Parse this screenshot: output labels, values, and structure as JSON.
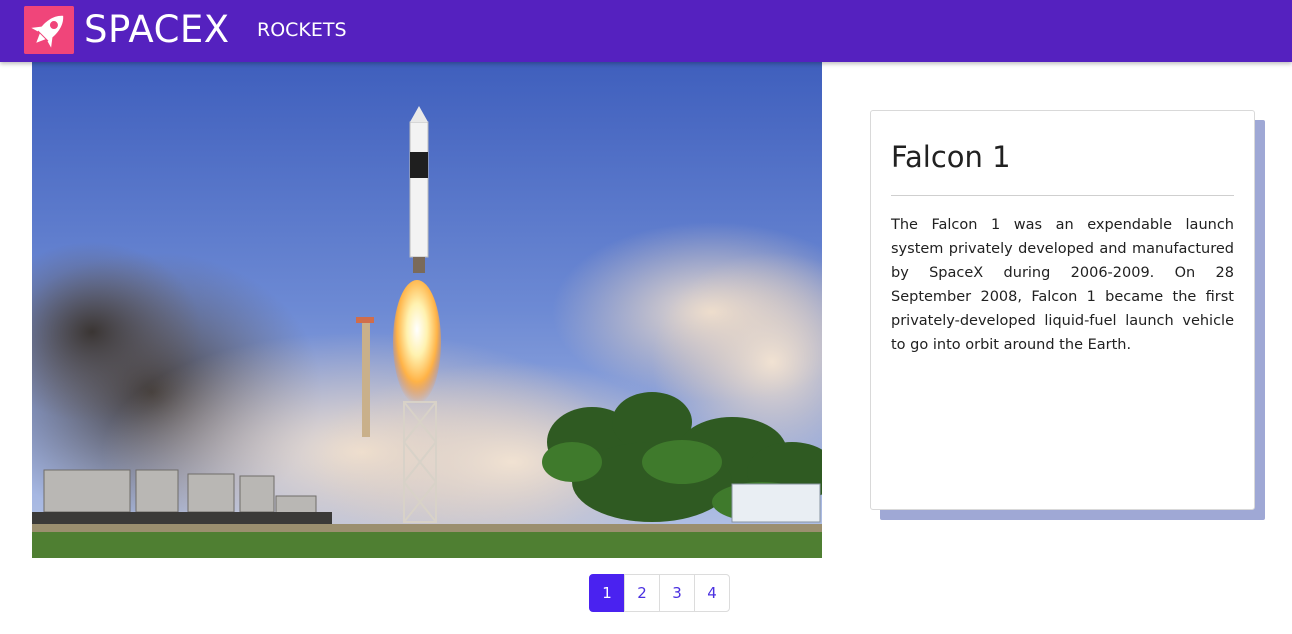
{
  "navbar": {
    "brand": "SPACEX",
    "links": [
      {
        "label": "ROCKETS"
      }
    ],
    "logo_icon": "rocket-icon",
    "logo_color": "#f0457a",
    "background_color": "#5521bf"
  },
  "hero": {
    "image": "falcon-1-launch-photo"
  },
  "rocket_card": {
    "title": "Falcon 1",
    "description": "The Falcon 1 was an expendable launch system privately developed and manufactured by SpaceX during 2006-2009. On 28 September 2008, Falcon 1 became the first privately-developed liquid-fuel launch vehicle to go into orbit around the Earth."
  },
  "pagination": {
    "pages": [
      "1",
      "2",
      "3",
      "4"
    ],
    "active_page": "1",
    "active_color": "#4a22f0"
  }
}
